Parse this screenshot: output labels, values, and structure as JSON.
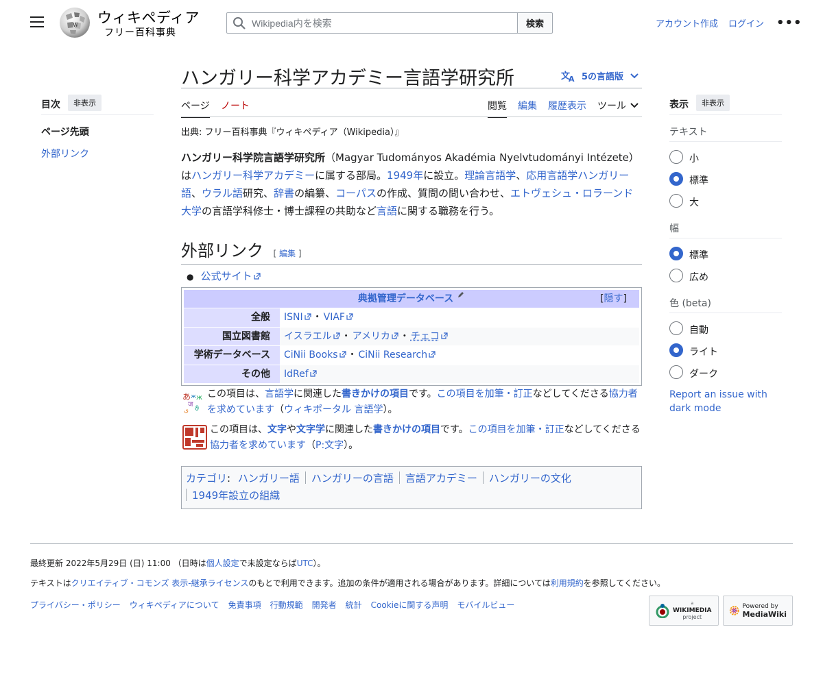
{
  "header": {
    "logo_title": "ウィキペディア",
    "logo_subtitle": "フリー百科事典",
    "search_placeholder": "Wikipedia内を検索",
    "search_button": "検索",
    "create_account": "アカウント作成",
    "login": "ログイン",
    "more": "•••"
  },
  "toc": {
    "title": "目次",
    "hide": "非表示",
    "items": [
      "ページ先頭",
      "外部リンク"
    ]
  },
  "page": {
    "title": "ハンガリー科学アカデミー言語学研究所",
    "languages": "5の言語版",
    "tabs_left": [
      "ページ",
      "ノート"
    ],
    "tabs_right": [
      "閲覧",
      "編集",
      "履歴表示",
      "ツール"
    ],
    "site_sub": "出典: フリー百科事典『ウィキペディア（Wikipedia）』"
  },
  "body": {
    "p1": "ハンガリー科学院言語学研究所",
    "p2": "（Magyar Tudományos Akadémia Nyelvtudományi Intézete）は",
    "p3": "ハンガリー科学アカデミー",
    "p4": "に属する部局。",
    "p5": "1949年",
    "p6": "に設立。",
    "p7": "理論言語学",
    "p8": "、",
    "p9": "応用言語学",
    "p10": "ハンガリー語",
    "p11": "、",
    "p12": "ウラル語",
    "p13": "研究、",
    "p14": "辞書",
    "p15": "の編纂、",
    "p16": "コーパス",
    "p17": "の作成、質問の問い合わせ、",
    "p18": "エトヴェシュ・ロラーンド大学",
    "p19": "の言語学科修士・博士課程の共助など",
    "p20": "言語",
    "p21": "に関する職務を行う。"
  },
  "section": {
    "heading": "外部リンク",
    "edit_open": "[",
    "edit": "編集",
    "edit_close": "]",
    "bullet": "公式サイト"
  },
  "authority": {
    "title": "典拠管理データベース",
    "hide_open": "[",
    "hide": "隠す",
    "hide_close": "]",
    "sep": "・",
    "rows": [
      {
        "label": "全般",
        "links": [
          "ISNI",
          "VIAF"
        ]
      },
      {
        "label": "国立図書館",
        "links": [
          "イスラエル",
          "アメリカ",
          "チェコ"
        ]
      },
      {
        "label": "学術データベース",
        "links": [
          "CiNii Books",
          "CiNii Research"
        ]
      },
      {
        "label": "その他",
        "links": [
          "IdRef"
        ]
      }
    ]
  },
  "stub1": {
    "a": "この項目は、",
    "b": "言語学",
    "c": "に関連した",
    "d": "書きかけの項目",
    "e": "です。",
    "f": "この項目を加筆・訂正",
    "g": "などしてくださる",
    "h": "協力者を求めています",
    "i": "（",
    "j": "ウィキポータル 言語学",
    "k": "）。"
  },
  "stub2": {
    "a": "この項目は、",
    "b": "文字",
    "c": "や",
    "d": "文字学",
    "e": "に関連した",
    "f": "書きかけの項目",
    "g": "です。",
    "h": "この項目を加筆・訂正",
    "i": "などしてくださる",
    "j": "協力者を求めています",
    "k": "（",
    "l": "P:文字",
    "m": "）。"
  },
  "categories": {
    "label": "カテゴリ",
    "colon": ":",
    "items": [
      "ハンガリー語",
      "ハンガリーの言語",
      "言語アカデミー",
      "ハンガリーの文化",
      "1949年設立の組織"
    ]
  },
  "display": {
    "title": "表示",
    "hide": "非表示",
    "text_group": "テキスト",
    "text_options": [
      "小",
      "標準",
      "大"
    ],
    "width_group": "幅",
    "width_options": [
      "標準",
      "広め"
    ],
    "color_group": "色 (beta)",
    "color_options": [
      "自動",
      "ライト",
      "ダーク"
    ],
    "report": "Report an issue with dark mode"
  },
  "footer": {
    "updated_a": "最終更新 2022年5月29日 (日) 11:00 （日時は",
    "updated_b": "個人設定",
    "updated_c": "で未設定ならば",
    "updated_d": "UTC",
    "updated_e": "）。",
    "license_a": "テキストは",
    "license_b": "クリエイティブ・コモンズ 表示-継承ライセンス",
    "license_c": "のもとで利用できます。追加の条件が適用される場合があります。詳細については",
    "license_d": "利用規約",
    "license_e": "を参照してください。",
    "links": [
      "プライバシー・ポリシー",
      "ウィキペディアについて",
      "免責事項",
      "行動規範",
      "開発者",
      "統計",
      "Cookieに関する声明",
      "モバイルビュー"
    ],
    "wikimedia_small": "a",
    "wikimedia_big": "WIKIMEDIA",
    "wikimedia_sub": "project",
    "mediawiki_small": "Powered by",
    "mediawiki_big": "MediaWiki"
  },
  "colors": {
    "link": "#3366cc",
    "red_link": "#ba0000",
    "authority_header": "#ccccff",
    "authority_label": "#ddddff"
  }
}
